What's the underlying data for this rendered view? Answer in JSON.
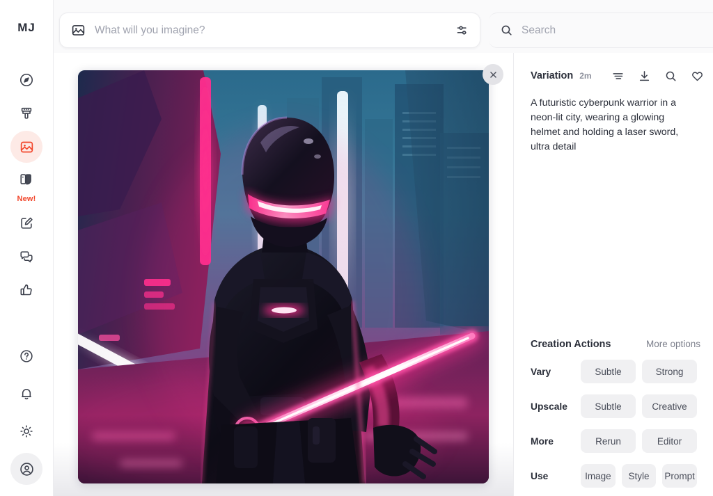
{
  "app": {
    "brand": "MJ"
  },
  "sidebar": {
    "items": [
      {
        "name": "explore",
        "icon": "compass-icon",
        "label": "",
        "active": false
      },
      {
        "name": "edit-brush",
        "icon": "paintbrush-icon",
        "label": "",
        "active": false
      },
      {
        "name": "create",
        "icon": "image-icon",
        "label": "",
        "active": true
      },
      {
        "name": "personalize",
        "icon": "palette-icon",
        "label": "New!",
        "active": false
      },
      {
        "name": "editor",
        "icon": "pencil-square-icon",
        "label": "",
        "active": false
      },
      {
        "name": "chat",
        "icon": "chat-bubbles-icon",
        "label": "",
        "active": false
      },
      {
        "name": "rate",
        "icon": "thumbs-up-icon",
        "label": "",
        "active": false
      }
    ],
    "bottom_items": [
      {
        "name": "help",
        "icon": "question-circle-icon"
      },
      {
        "name": "notifications",
        "icon": "bell-icon"
      },
      {
        "name": "theme",
        "icon": "sun-icon"
      },
      {
        "name": "account",
        "icon": "user-circle-icon"
      }
    ],
    "badge_color": "#f2452a",
    "active_bg": "#fdeae6"
  },
  "prompt_bar": {
    "placeholder": "What will you imagine?",
    "value": "",
    "image_icon": "image-icon",
    "settings_icon": "sliders-icon"
  },
  "search_bar": {
    "placeholder": "Search",
    "value": "",
    "icon": "search-icon"
  },
  "viewer": {
    "close_icon": "close-icon",
    "image_alt": "A futuristic cyberpunk warrior in a neon-lit city, wearing a glowing helmet and holding a laser sword, ultra detail"
  },
  "details": {
    "title": "Variation",
    "time": "2m",
    "icons": [
      {
        "name": "list-icon"
      },
      {
        "name": "download-icon"
      },
      {
        "name": "search-icon"
      },
      {
        "name": "heart-icon"
      }
    ],
    "prompt": "A futuristic cyberpunk warrior in a neon-lit city, wearing a glowing helmet and holding a laser sword, ultra detail"
  },
  "creation_actions": {
    "title": "Creation Actions",
    "more_options": "More options",
    "rows": [
      {
        "label": "Vary",
        "buttons": [
          "Subtle",
          "Strong"
        ]
      },
      {
        "label": "Upscale",
        "buttons": [
          "Subtle",
          "Creative"
        ]
      },
      {
        "label": "More",
        "buttons": [
          "Rerun",
          "Editor"
        ]
      },
      {
        "label": "Use",
        "buttons": [
          "Image",
          "Style",
          "Prompt"
        ]
      }
    ]
  },
  "colors": {
    "accent": "#f2452a",
    "neon_pink": "#ff2f8e",
    "panel_border": "#ececef",
    "button_bg": "#f0f0f2"
  }
}
